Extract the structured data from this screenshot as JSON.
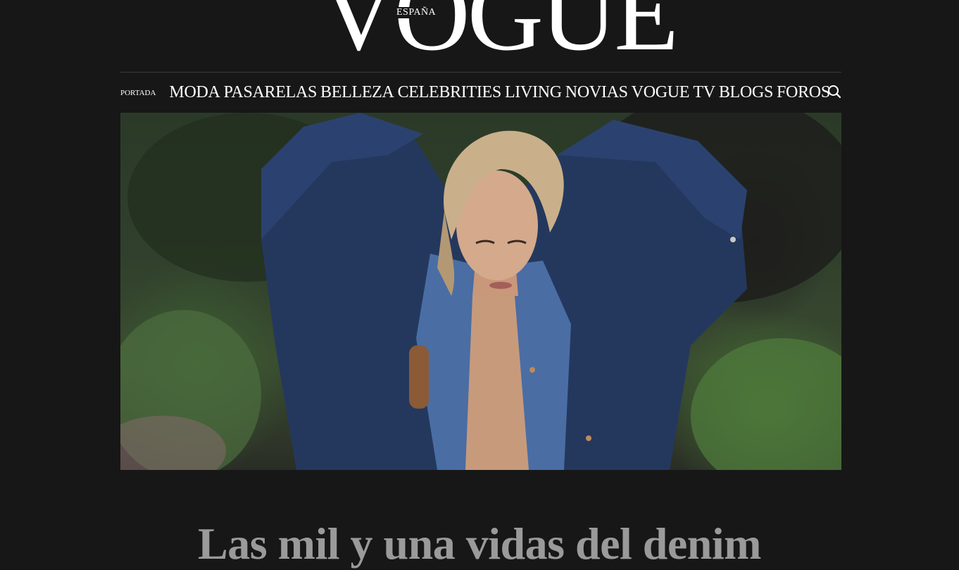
{
  "brand": {
    "logo": "VOGUE",
    "edition": "ESPAÑA"
  },
  "nav": {
    "home": "PORTADA",
    "items": [
      "MODA",
      "PASARELAS",
      "BELLEZA",
      "CELEBRITIES",
      "LIVING",
      "NOVIAS",
      "VOGUE TV",
      "BLOGS",
      "FOROS"
    ],
    "search_icon": "search-icon"
  },
  "article": {
    "headline": "Las mil y una vidas del denim"
  },
  "colors": {
    "background": "#171717",
    "text": "#ffffff",
    "headline": "#9a9a9a"
  }
}
